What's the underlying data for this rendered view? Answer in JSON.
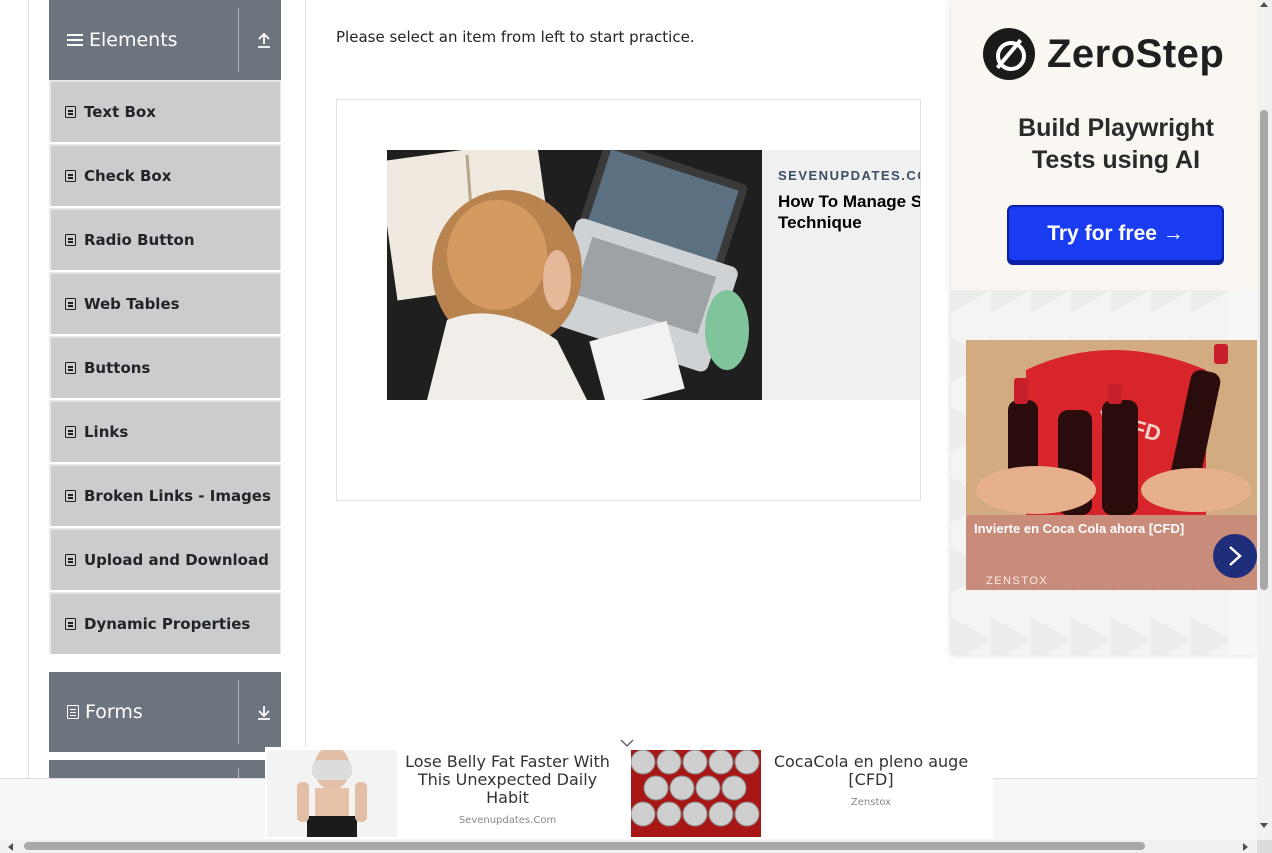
{
  "sidebar": {
    "elements_header": {
      "title": "Elements",
      "icon": "hamburger-icon",
      "toggle_icon": "upload-arrow-icon"
    },
    "items": [
      {
        "label": "Text Box"
      },
      {
        "label": "Check Box"
      },
      {
        "label": "Radio Button"
      },
      {
        "label": "Web Tables"
      },
      {
        "label": "Buttons"
      },
      {
        "label": "Links"
      },
      {
        "label": "Broken Links - Images"
      },
      {
        "label": "Upload and Download"
      },
      {
        "label": "Dynamic Properties"
      }
    ],
    "forms_header": {
      "title": "Forms",
      "icon": "document-icon",
      "toggle_icon": "download-arrow-icon"
    }
  },
  "main": {
    "intro": "Please select an item from left to start practice.",
    "ad": {
      "source": "SEVENUPDATES.COM",
      "headline_line1": "How To Manage Stre",
      "headline_line2": "Technique"
    }
  },
  "right_ad": {
    "brand": "ZeroStep",
    "tagline_line1": "Build Playwright",
    "tagline_line2": "Tests using AI",
    "cta": "Try for free →",
    "card": {
      "title": "Invierte en Coca Cola ahora [CFD]",
      "brand": "ZENSTOX",
      "next_icon": "chevron-right-icon"
    }
  },
  "sticky_ad": {
    "item1": {
      "text": "Lose Belly Fat Faster With This Unexpected Daily Habit",
      "source": "Sevenupdates.Com"
    },
    "item2": {
      "text": "CocaCola en pleno auge [CFD]",
      "source": "Zenstox"
    },
    "close_icon": "chevron-down-icon"
  },
  "colors": {
    "group_header_bg": "#6c757d",
    "menu_item_bg": "#cccccc",
    "cta_blue": "#1a3cf0",
    "coke_caption_bg": "#c98c7b"
  }
}
